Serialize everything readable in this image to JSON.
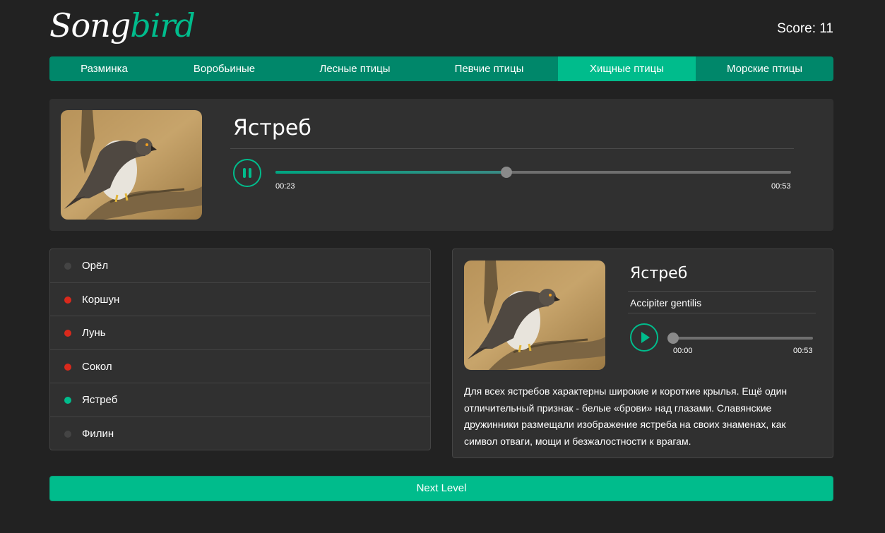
{
  "logo": {
    "part1": "Song",
    "part2": "bird"
  },
  "score": "Score: 11",
  "nav": [
    {
      "label": "Разминка",
      "active": false
    },
    {
      "label": "Воробьиные",
      "active": false
    },
    {
      "label": "Лесные птицы",
      "active": false
    },
    {
      "label": "Певчие птицы",
      "active": false
    },
    {
      "label": "Хищные птицы",
      "active": true
    },
    {
      "label": "Морские птицы",
      "active": false
    }
  ],
  "current": {
    "name": "Ястреб",
    "image_icon": "hawk-photo",
    "player": {
      "state": "playing",
      "time_current": "00:23",
      "time_duration": "00:53",
      "progress": 0.4474
    }
  },
  "answers": [
    {
      "label": "Орёл",
      "status": "unchecked"
    },
    {
      "label": "Коршун",
      "status": "wrong"
    },
    {
      "label": "Лунь",
      "status": "wrong"
    },
    {
      "label": "Сокол",
      "status": "wrong"
    },
    {
      "label": "Ястреб",
      "status": "correct"
    },
    {
      "label": "Филин",
      "status": "unchecked"
    }
  ],
  "details": {
    "name": "Ястреб",
    "latin": "Accipiter gentilis",
    "image_icon": "hawk-photo",
    "player": {
      "state": "paused",
      "time_current": "00:00",
      "time_duration": "00:53",
      "progress": 0
    },
    "description": "Для всех ястребов характерны широкие и короткие крылья. Ещё один отличительный признак - белые «брови» над глазами. Славянские дружинники размещали изображение ястреба на своих знаменах, как символ отваги, мощи и безжалостности к врагам."
  },
  "next_button": "Next Level",
  "colors": {
    "accent": "#00bc8c",
    "nav_bg": "#00876a",
    "panel_bg": "#303030",
    "page_bg": "#222222",
    "dot_correct": "#00bc8c",
    "dot_wrong": "#d9291c",
    "dot_unchecked": "#444444"
  }
}
